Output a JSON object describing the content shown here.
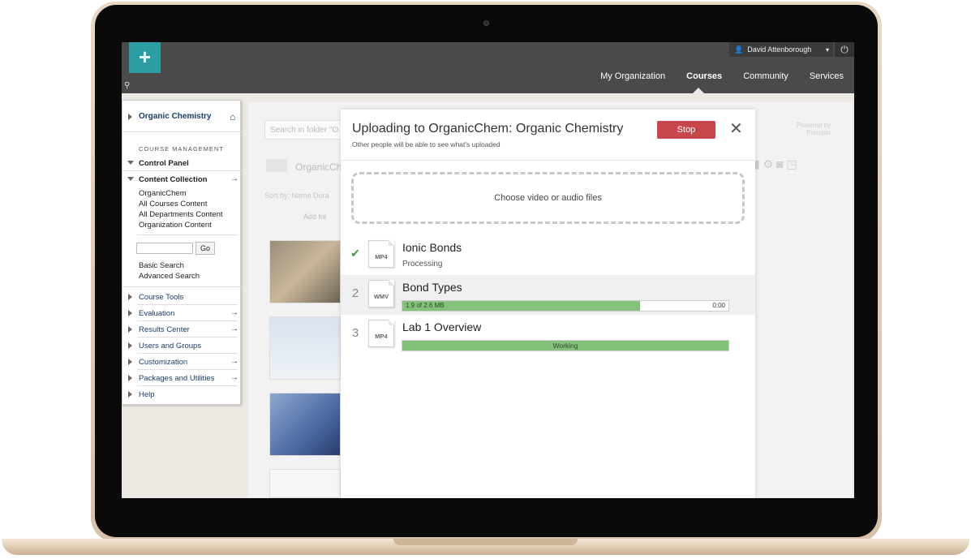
{
  "header": {
    "logo_glyph": "+",
    "user_name": "David Attenborough",
    "user_caret": "▾",
    "power_glyph": "⏻",
    "nav": [
      "My Organization",
      "Courses",
      "Community",
      "Services"
    ],
    "nav_active": "Courses"
  },
  "sidebar": {
    "course_title": "Organic Chemistry",
    "section_heading": "COURSE MANAGEMENT",
    "control_panel": "Control Panel",
    "content_collection": "Content Collection",
    "content_links": [
      "OrganicChem",
      "All Courses Content",
      "All Departments Content",
      "Organization Content"
    ],
    "go_label": "Go",
    "basic_search": "Basic Search",
    "advanced_search": "Advanced Search",
    "menu_items": [
      "Course Tools",
      "Evaluation",
      "Results Center",
      "Users and Groups",
      "Customization",
      "Packages and Utilities",
      "Help"
    ],
    "arrow_glyph": "→"
  },
  "background_page": {
    "search_placeholder": "Search in folder \"O",
    "folder_name": "OrganicChe",
    "sort_text": "Sort by:   Name   Dura",
    "add_folder": "Add fol",
    "powered_by": "Powered by Panopto"
  },
  "upload_dialog": {
    "title": "Uploading to OrganicChem: Organic Chemistry",
    "subtitle": "Other people will be able to see what's uploaded",
    "stop_label": "Stop",
    "close_glyph": "✕",
    "dropzone_label": "Choose video or audio files",
    "files": [
      {
        "marker": "✔",
        "ext": "MP4",
        "name": "Ionic Bonds",
        "status": "Processing"
      },
      {
        "marker": "2",
        "ext": "WMV",
        "name": "Bond Types",
        "progress_label": "1.9 of 2.6 MB",
        "progress_fraction": 0.73,
        "time": "0:00"
      },
      {
        "marker": "3",
        "ext": "MP4",
        "name": "Lab 1 Overview",
        "progress_label": "Working",
        "progress_fraction": 1.0
      }
    ]
  },
  "colors": {
    "accent_teal": "#2a9ea3",
    "stop_red": "#c9474a",
    "progress_green": "#84c27b",
    "course_link_blue": "#1b3f6b"
  }
}
